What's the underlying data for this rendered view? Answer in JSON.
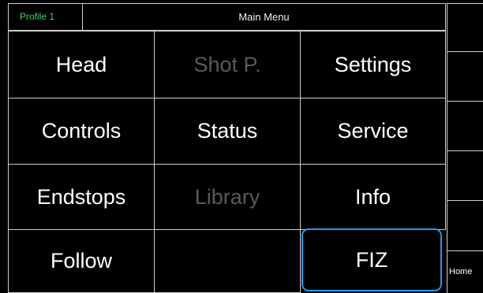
{
  "header": {
    "profile_label": "Profile 1",
    "title": "Main Menu"
  },
  "menu": {
    "items": [
      {
        "label": "Head",
        "state": "enabled"
      },
      {
        "label": "Shot P.",
        "state": "disabled"
      },
      {
        "label": "Settings",
        "state": "enabled"
      },
      {
        "label": "Controls",
        "state": "enabled"
      },
      {
        "label": "Status",
        "state": "enabled"
      },
      {
        "label": "Service",
        "state": "enabled"
      },
      {
        "label": "Endstops",
        "state": "enabled"
      },
      {
        "label": "Library",
        "state": "disabled"
      },
      {
        "label": "Info",
        "state": "enabled"
      },
      {
        "label": "Follow",
        "state": "enabled"
      },
      {
        "label": "",
        "state": "empty"
      },
      {
        "label": "FIZ",
        "state": "selected"
      }
    ]
  },
  "side": {
    "home_label": "Home"
  },
  "colors": {
    "background": "#000000",
    "grid_line": "#cfcfcf",
    "profile_text": "#3bd86a",
    "disabled_text": "#5a5a5a",
    "selection_border": "#1e9cf0"
  }
}
